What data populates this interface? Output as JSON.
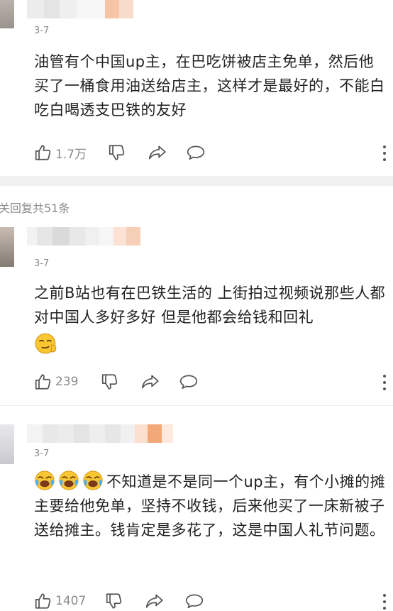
{
  "colors": {
    "text": "#222222",
    "meta": "#8a8a8a",
    "icon": "#555555",
    "divider": "#f1f1f1",
    "accent_orange": "#f2a878"
  },
  "comments": [
    {
      "date": "3-7",
      "text": "油管有个中国up主，在巴吃饼被店主免单，然后他买了一桶食用油送给店主，这样才是最好的，不能白吃白喝透支巴铁的友好",
      "likes": "1.7万"
    },
    {
      "date": "3-7",
      "text": "之前B站也有在巴铁生活的 上街拍过视频说那些人都对中国人多好多好 但是他都会给钱和回礼",
      "emojis": [
        "smirk-emoji-icon"
      ],
      "likes": "239"
    },
    {
      "date": "3-7",
      "emojis": [
        "laugh-cry-emoji-icon",
        "laugh-cry-emoji-icon",
        "laugh-cry-emoji-icon"
      ],
      "text": "不知道是不是同一个up主，有个小摊的摊主要给他免单，坚持不收钱，后来他买了一床新被子送给摊主。钱肯定是多花了，这是中国人礼节问题。",
      "likes": "1407"
    }
  ],
  "replies_toggle": "关回复共51条"
}
